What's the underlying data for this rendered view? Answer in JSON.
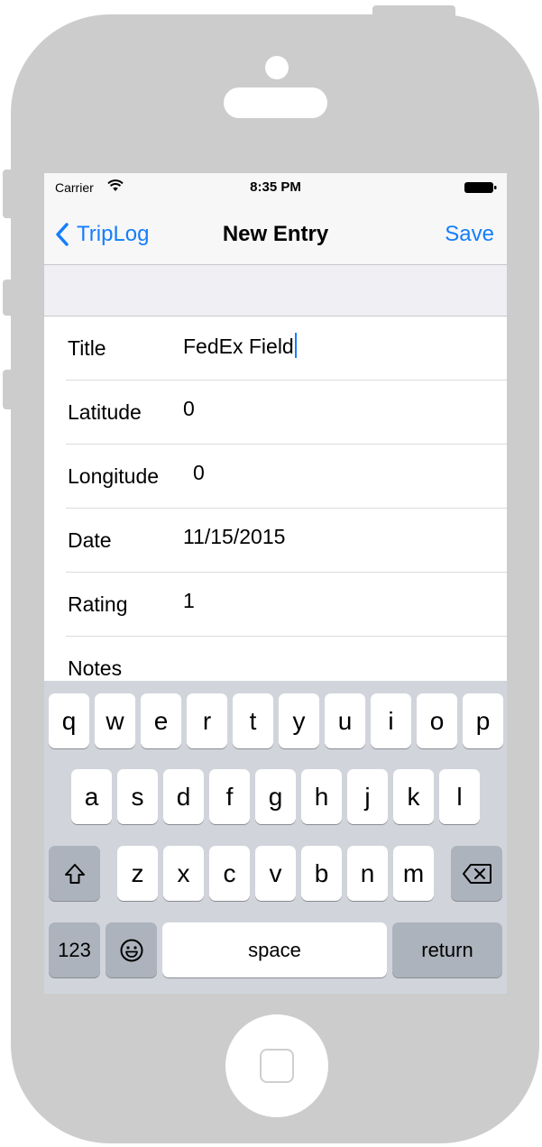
{
  "status_bar": {
    "carrier": "Carrier",
    "time": "8:35 PM",
    "wifi_icon": "wifi-icon",
    "battery_icon": "battery-icon"
  },
  "nav": {
    "back_label": "TripLog",
    "title": "New Entry",
    "save_label": "Save",
    "accent_color": "#157efb"
  },
  "form": {
    "rows": [
      {
        "label": "Title",
        "value": "FedEx Field"
      },
      {
        "label": "Latitude",
        "value": "0"
      },
      {
        "label": "Longitude",
        "value": "0"
      },
      {
        "label": "Date",
        "value": "11/15/2015"
      },
      {
        "label": "Rating",
        "value": "1"
      },
      {
        "label": "Notes",
        "value": ""
      }
    ]
  },
  "keyboard": {
    "row1": [
      "q",
      "w",
      "e",
      "r",
      "t",
      "y",
      "u",
      "i",
      "o",
      "p"
    ],
    "row2": [
      "a",
      "s",
      "d",
      "f",
      "g",
      "h",
      "j",
      "k",
      "l"
    ],
    "row3": [
      "z",
      "x",
      "c",
      "v",
      "b",
      "n",
      "m"
    ],
    "numbers_label": "123",
    "space_label": "space",
    "return_label": "return",
    "shift_icon": "shift-icon",
    "delete_icon": "delete-icon",
    "emoji_icon": "emoji-icon"
  }
}
